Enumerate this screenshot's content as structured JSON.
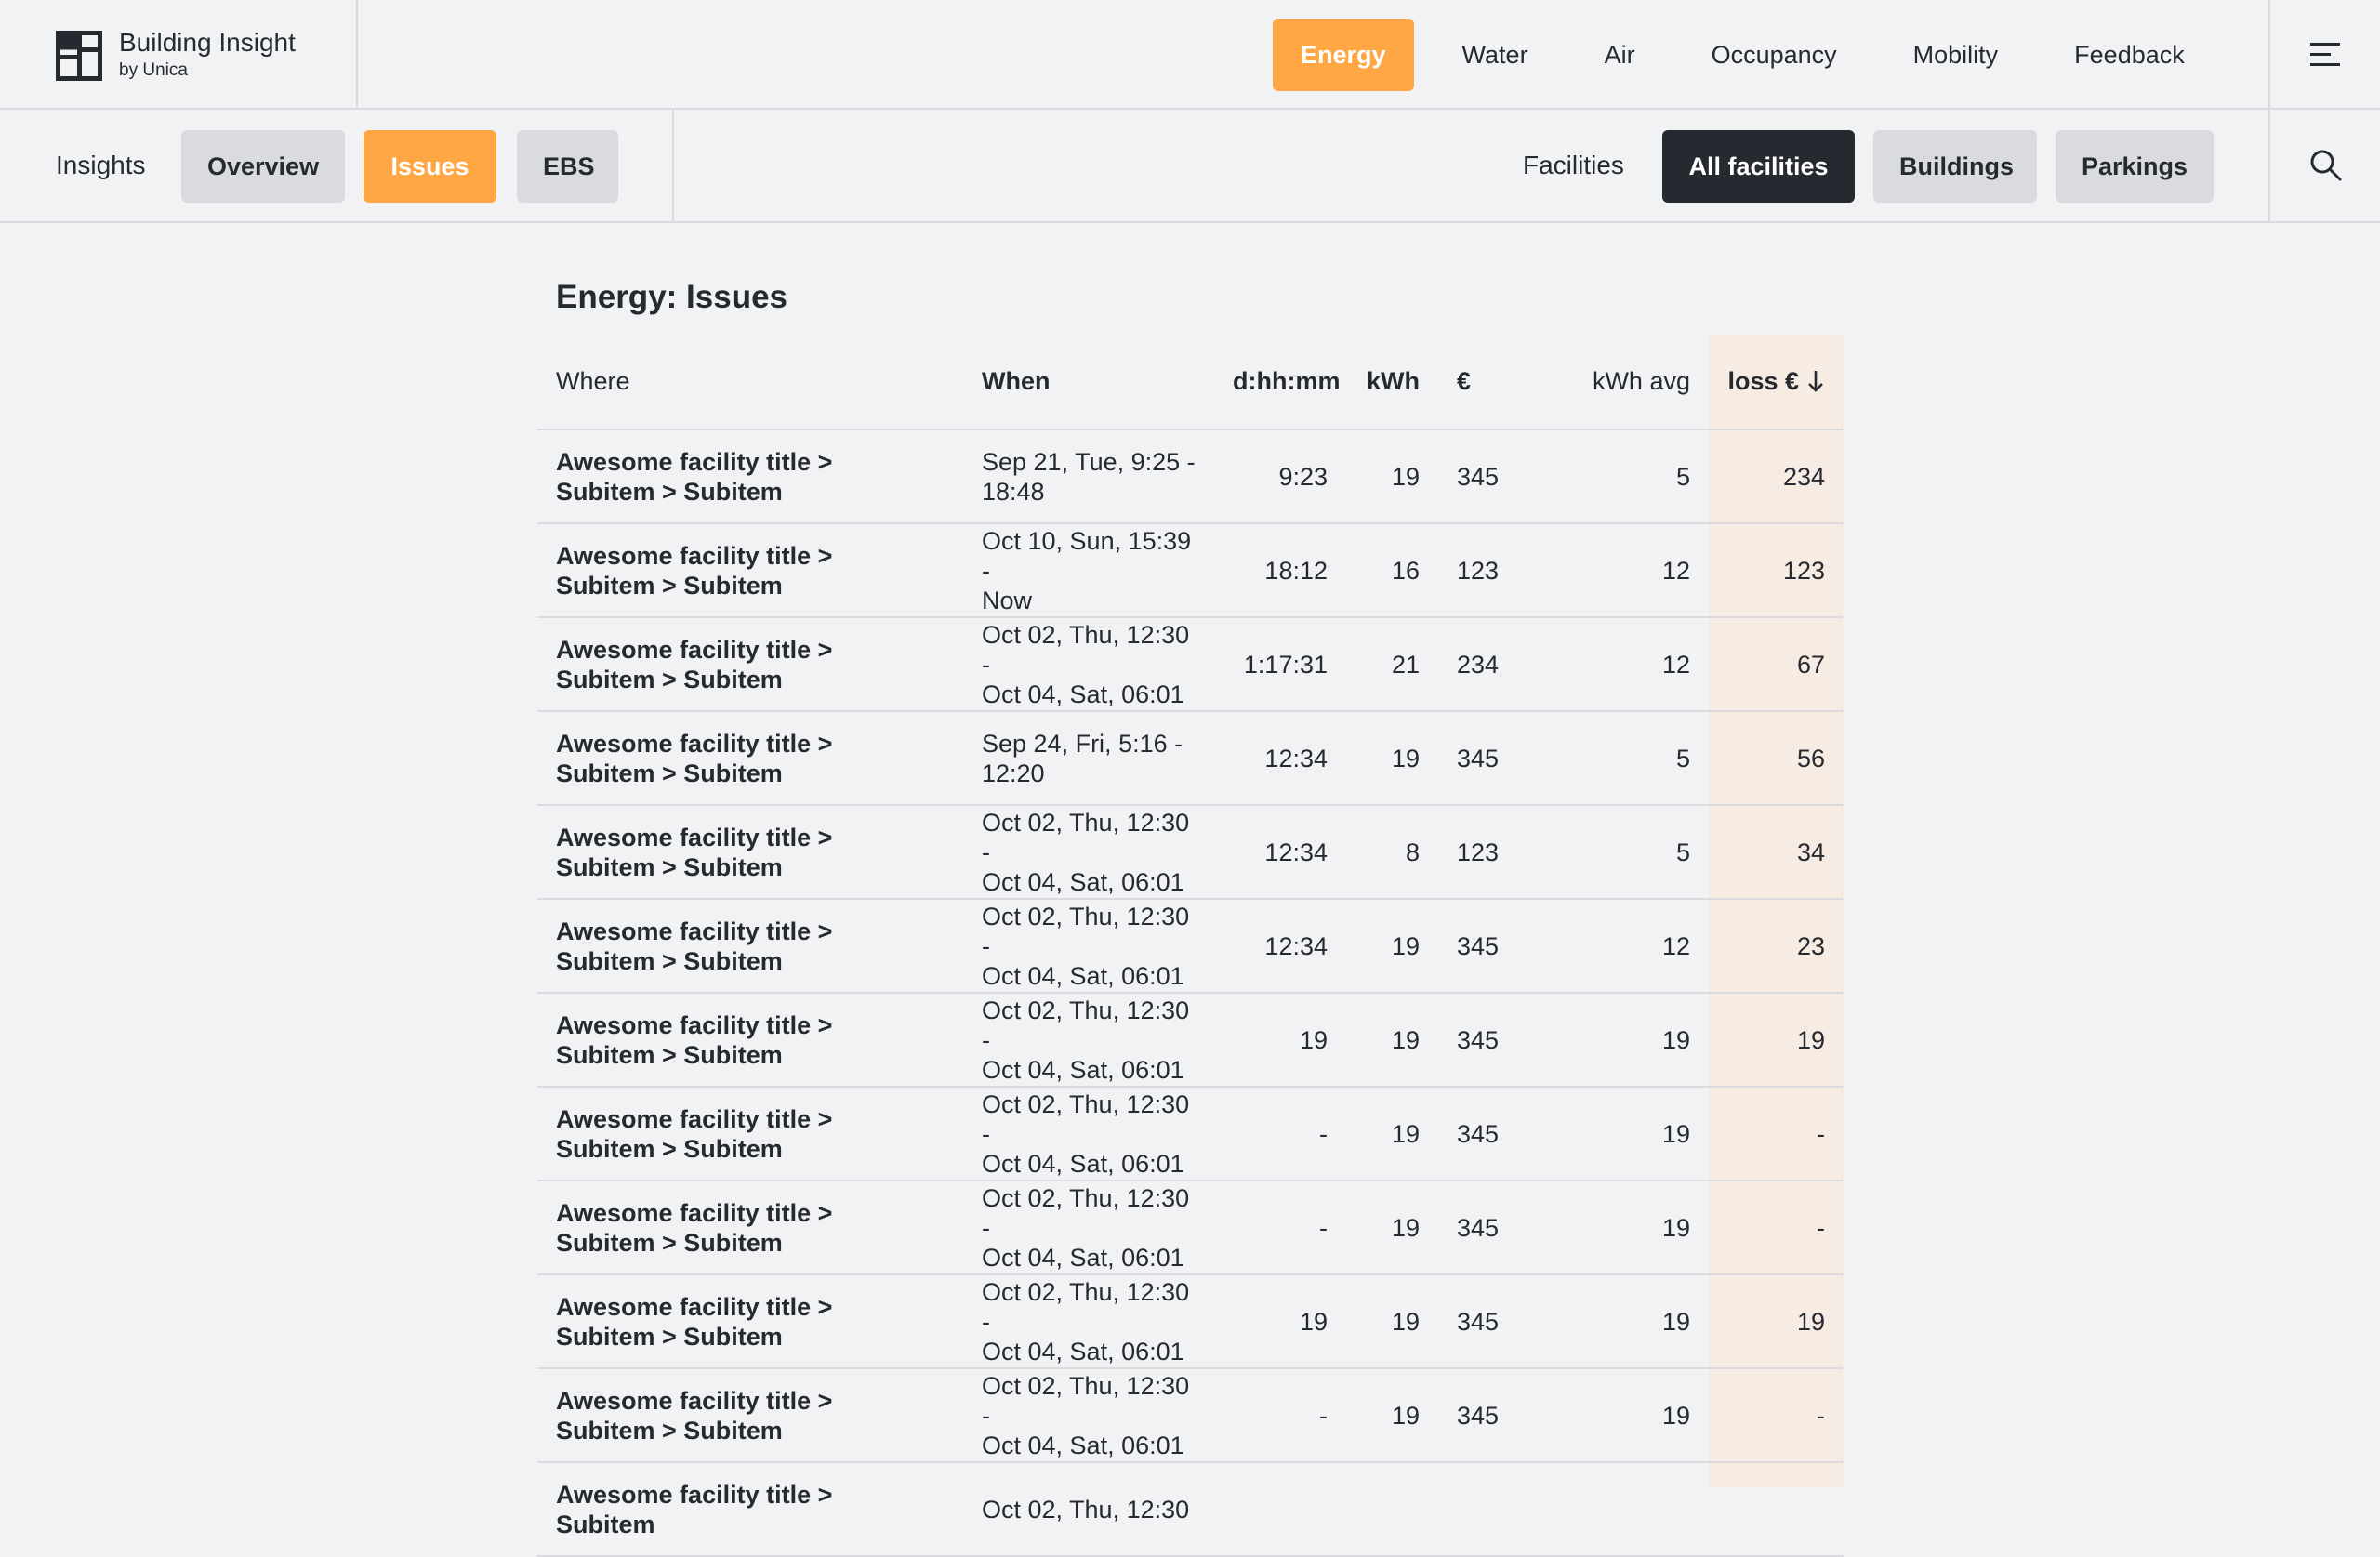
{
  "brand": {
    "title": "Building Insight",
    "subtitle": "by Unica"
  },
  "main_nav": [
    {
      "label": "Energy",
      "active": true
    },
    {
      "label": "Water",
      "active": false
    },
    {
      "label": "Air",
      "active": false
    },
    {
      "label": "Occupancy",
      "active": false
    },
    {
      "label": "Mobility",
      "active": false
    },
    {
      "label": "Feedback",
      "active": false
    }
  ],
  "sub_nav": {
    "section_label": "Insights",
    "tabs": [
      {
        "label": "Overview",
        "active": false
      },
      {
        "label": "Issues",
        "active": true
      },
      {
        "label": "EBS",
        "active": false
      }
    ],
    "filter_label": "Facilities",
    "filters": [
      {
        "label": "All facilities",
        "active": true
      },
      {
        "label": "Buildings",
        "active": false
      },
      {
        "label": "Parkings",
        "active": false
      }
    ]
  },
  "page": {
    "title": "Energy: Issues"
  },
  "table": {
    "columns": [
      "Where",
      "When",
      "d:hh:mm",
      "kWh",
      "€",
      "kWh avg",
      "loss €"
    ],
    "sort_column": "loss €",
    "sort_direction": "descending",
    "rows": [
      {
        "where": "Awesome facility title > Subitem > Subitem",
        "when": "Sep 21, Tue, 9:25 -\n18:48",
        "duration": "9:23",
        "kwh": "19",
        "eur": "345",
        "kwh_avg": "5",
        "loss": "234"
      },
      {
        "where": "Awesome facility title > Subitem > Subitem",
        "when": "Oct 10, Sun, 15:39 -\nNow",
        "duration": "18:12",
        "kwh": "16",
        "eur": "123",
        "kwh_avg": "12",
        "loss": "123"
      },
      {
        "where": "Awesome facility title > Subitem > Subitem",
        "when": "Oct 02, Thu, 12:30 -\nOct 04, Sat, 06:01",
        "duration": "1:17:31",
        "kwh": "21",
        "eur": "234",
        "kwh_avg": "12",
        "loss": "67"
      },
      {
        "where": "Awesome facility title > Subitem > Subitem",
        "when": "Sep 24, Fri, 5:16 -\n12:20",
        "duration": "12:34",
        "kwh": "19",
        "eur": "345",
        "kwh_avg": "5",
        "loss": "56"
      },
      {
        "where": "Awesome facility title > Subitem > Subitem",
        "when": "Oct 02, Thu, 12:30 -\nOct 04, Sat, 06:01",
        "duration": "12:34",
        "kwh": "8",
        "eur": "123",
        "kwh_avg": "5",
        "loss": "34"
      },
      {
        "where": "Awesome facility title > Subitem > Subitem",
        "when": "Oct 02, Thu, 12:30 -\nOct 04, Sat, 06:01",
        "duration": "12:34",
        "kwh": "19",
        "eur": "345",
        "kwh_avg": "12",
        "loss": "23"
      },
      {
        "where": "Awesome facility title > Subitem > Subitem",
        "when": "Oct 02, Thu, 12:30 -\nOct 04, Sat, 06:01",
        "duration": "19",
        "kwh": "19",
        "eur": "345",
        "kwh_avg": "19",
        "loss": "19"
      },
      {
        "where": "Awesome facility title > Subitem > Subitem",
        "when": "Oct 02, Thu, 12:30 -\nOct 04, Sat, 06:01",
        "duration": "-",
        "kwh": "19",
        "eur": "345",
        "kwh_avg": "19",
        "loss": "-"
      },
      {
        "where": "Awesome facility title > Subitem > Subitem",
        "when": "Oct 02, Thu, 12:30 -\nOct 04, Sat, 06:01",
        "duration": "-",
        "kwh": "19",
        "eur": "345",
        "kwh_avg": "19",
        "loss": "-"
      },
      {
        "where": "Awesome facility title > Subitem > Subitem",
        "when": "Oct 02, Thu, 12:30 -\nOct 04, Sat, 06:01",
        "duration": "19",
        "kwh": "19",
        "eur": "345",
        "kwh_avg": "19",
        "loss": "19"
      },
      {
        "where": "Awesome facility title > Subitem > Subitem",
        "when": "Oct 02, Thu, 12:30 -\nOct 04, Sat, 06:01",
        "duration": "-",
        "kwh": "19",
        "eur": "345",
        "kwh_avg": "19",
        "loss": "-"
      },
      {
        "where": "Awesome facility title > Subitem",
        "when": "Oct 02, Thu, 12:30",
        "duration": "",
        "kwh": "",
        "eur": "",
        "kwh_avg": "",
        "loss": ""
      }
    ]
  },
  "icons": {
    "menu": "menu-icon",
    "search": "search-icon",
    "sort": "arrow-down-icon",
    "logo": "logo-icon"
  },
  "colors": {
    "accent": "#ffa645",
    "dark": "#262a30",
    "pill": "#d9dbdf",
    "background": "#f1f2f4",
    "loss_column": "#f6ece3"
  }
}
